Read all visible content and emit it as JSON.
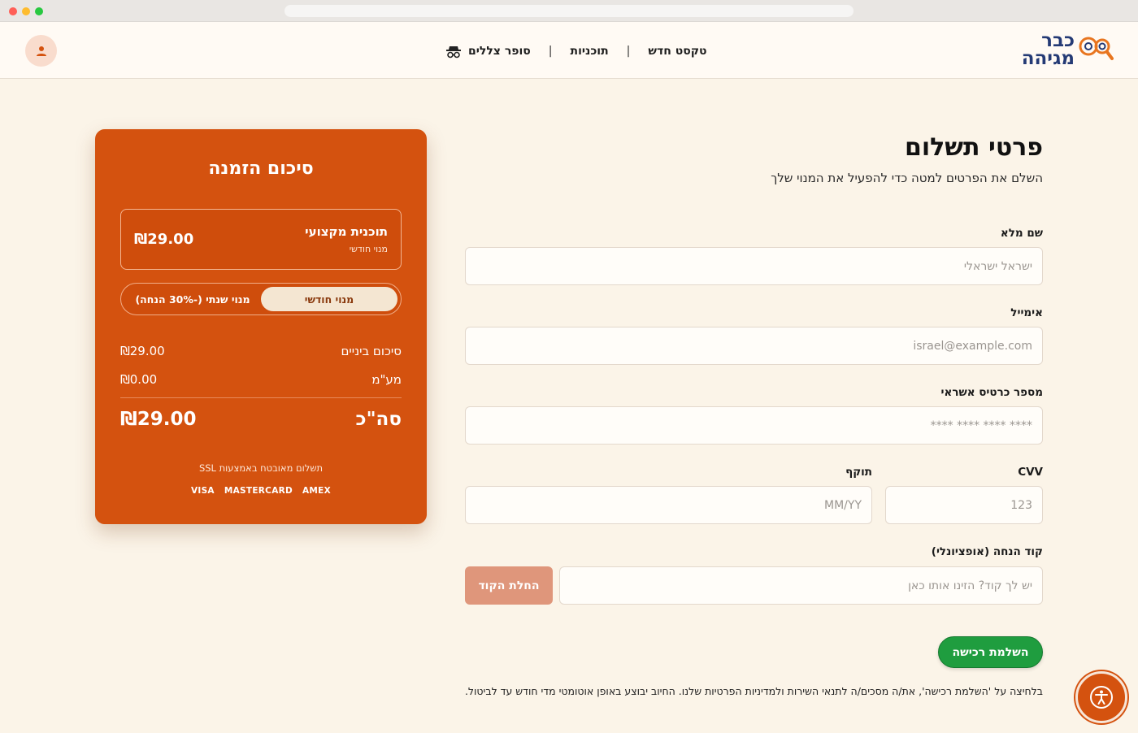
{
  "brand": {
    "logo_line1": "כבר",
    "logo_line2": "מגיהה",
    "accent": "#d4520f",
    "navy": "#243a75"
  },
  "nav": {
    "items": [
      {
        "label": "טקסט חדש"
      },
      {
        "label": "תוכניות"
      },
      {
        "label": "סופר צללים",
        "icon": "spy-icon"
      }
    ],
    "separator": "|"
  },
  "form": {
    "title": "פרטי תשלום",
    "subtitle": "השלם את הפרטים למטה כדי להפעיל את המנוי שלך",
    "full_name": {
      "label": "שם מלא",
      "placeholder": "ישראל ישראלי"
    },
    "email": {
      "label": "אימייל",
      "placeholder": "israel@example.com"
    },
    "card_number": {
      "label": "מספר כרטיס אשראי",
      "placeholder": "**** **** **** ****"
    },
    "cvv": {
      "label": "CVV",
      "placeholder": "123"
    },
    "expiry": {
      "label": "תוקף",
      "placeholder": "MM/YY"
    },
    "coupon": {
      "label": "קוד הנחה (אופציונלי)",
      "placeholder": "יש לך קוד? הזינו אותו כאן",
      "apply_label": "החלת הקוד"
    },
    "submit_label": "השלמת רכישה",
    "terms": "בלחיצה על 'השלמת רכישה', את/ה מסכים/ה לתנאי השירות ולמדיניות הפרטיות שלנו. החיוב יבוצע באופן אוטומטי מדי חודש עד לביטול."
  },
  "summary": {
    "title": "סיכום הזמנה",
    "plan_name": "תוכנית מקצועי",
    "plan_period": "מנוי חודשי",
    "plan_price": "₪29.00",
    "toggle_monthly": "מנוי חודשי",
    "toggle_yearly": "מנוי שנתי (-30% הנחה)",
    "subtotal_label": "סיכום ביניים",
    "subtotal_value": "₪29.00",
    "vat_label": "מע\"מ",
    "vat_value": "₪0.00",
    "total_label": "סה\"כ",
    "total_value": "₪29.00",
    "secure_note": "תשלום מאובטח באמצעות SSL",
    "brands": [
      "VISA",
      "MASTERCARD",
      "AMEX"
    ]
  }
}
